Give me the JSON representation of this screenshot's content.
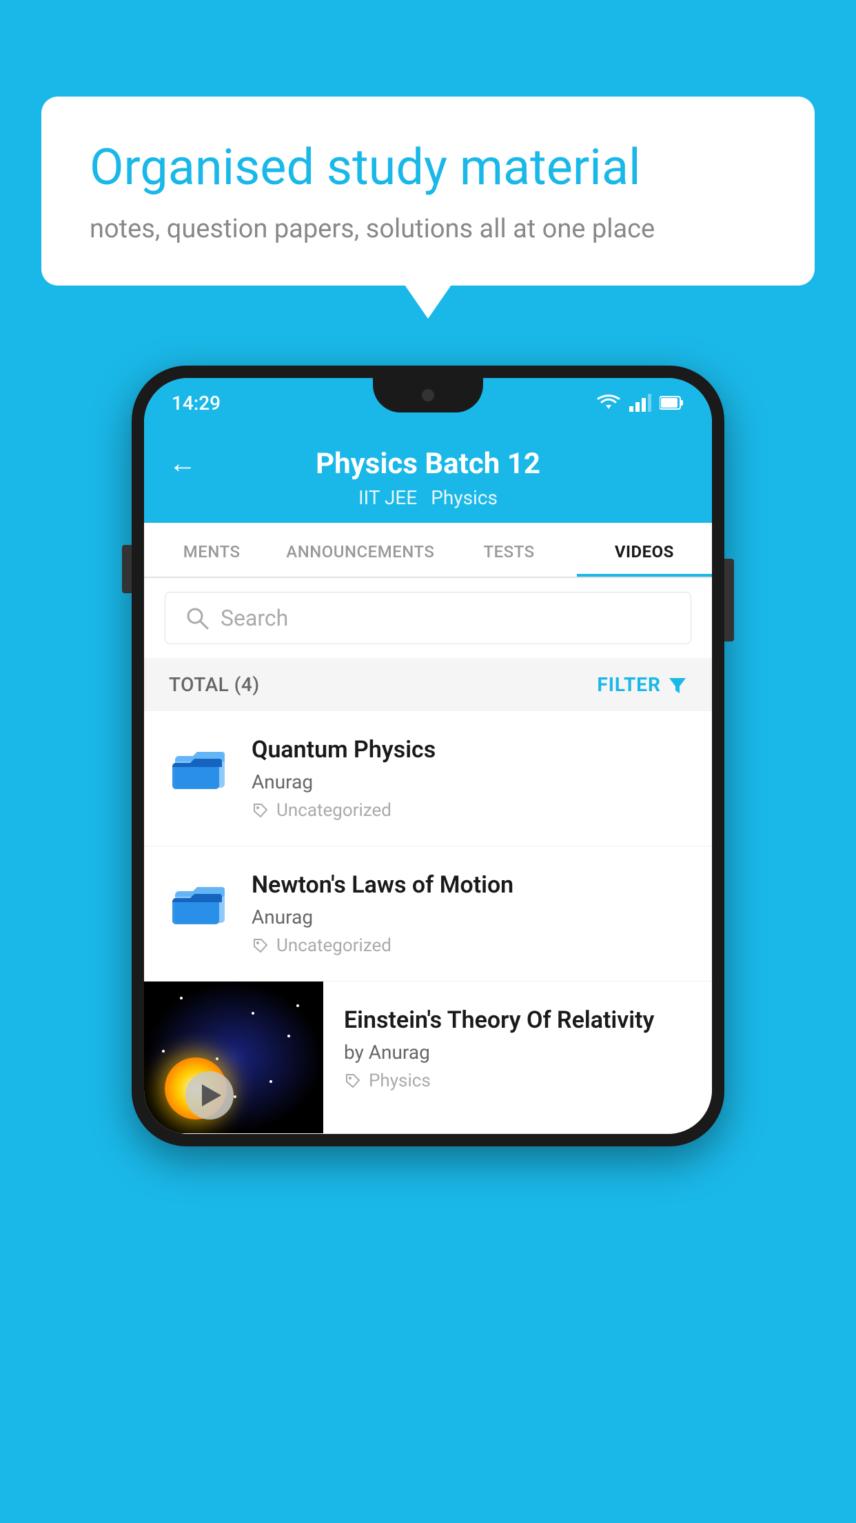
{
  "background_color": "#1ab8e8",
  "speech_bubble": {
    "title": "Organised study material",
    "subtitle": "notes, question papers, solutions all at one place"
  },
  "status_bar": {
    "time": "14:29",
    "wifi": "▼",
    "signal": "▲",
    "battery": "▐"
  },
  "app_header": {
    "back_label": "←",
    "title": "Physics Batch 12",
    "subtitle_left": "IIT JEE",
    "subtitle_right": "Physics"
  },
  "tabs": [
    {
      "label": "MENTS",
      "active": false
    },
    {
      "label": "ANNOUNCEMENTS",
      "active": false
    },
    {
      "label": "TESTS",
      "active": false
    },
    {
      "label": "VIDEOS",
      "active": true
    }
  ],
  "search": {
    "placeholder": "Search"
  },
  "filter_bar": {
    "total_label": "TOTAL (4)",
    "filter_label": "FILTER"
  },
  "videos": [
    {
      "title": "Quantum Physics",
      "author": "Anurag",
      "tag": "Uncategorized",
      "has_thumb": false
    },
    {
      "title": "Newton's Laws of Motion",
      "author": "Anurag",
      "tag": "Uncategorized",
      "has_thumb": false
    },
    {
      "title": "Einstein's Theory Of Relativity",
      "author": "by Anurag",
      "tag": "Physics",
      "has_thumb": true
    }
  ]
}
